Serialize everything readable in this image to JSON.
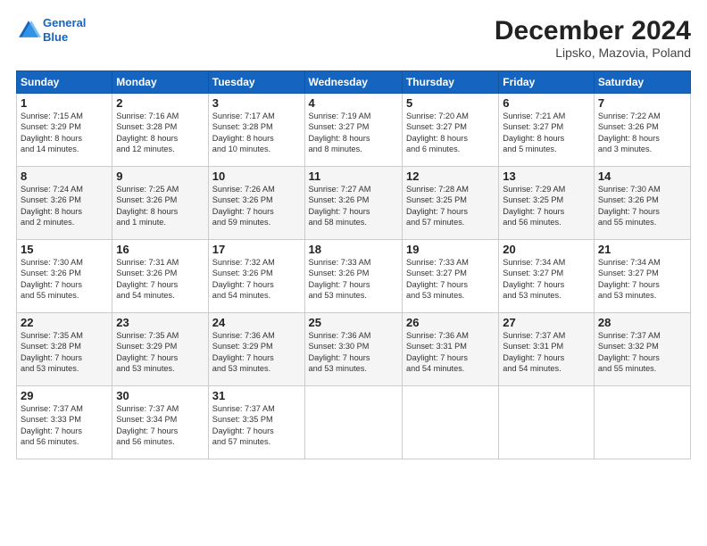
{
  "logo": {
    "line1": "General",
    "line2": "Blue"
  },
  "title": "December 2024",
  "subtitle": "Lipsko, Mazovia, Poland",
  "headers": [
    "Sunday",
    "Monday",
    "Tuesday",
    "Wednesday",
    "Thursday",
    "Friday",
    "Saturday"
  ],
  "weeks": [
    [
      {
        "day": "1",
        "info": "Sunrise: 7:15 AM\nSunset: 3:29 PM\nDaylight: 8 hours\nand 14 minutes."
      },
      {
        "day": "2",
        "info": "Sunrise: 7:16 AM\nSunset: 3:28 PM\nDaylight: 8 hours\nand 12 minutes."
      },
      {
        "day": "3",
        "info": "Sunrise: 7:17 AM\nSunset: 3:28 PM\nDaylight: 8 hours\nand 10 minutes."
      },
      {
        "day": "4",
        "info": "Sunrise: 7:19 AM\nSunset: 3:27 PM\nDaylight: 8 hours\nand 8 minutes."
      },
      {
        "day": "5",
        "info": "Sunrise: 7:20 AM\nSunset: 3:27 PM\nDaylight: 8 hours\nand 6 minutes."
      },
      {
        "day": "6",
        "info": "Sunrise: 7:21 AM\nSunset: 3:27 PM\nDaylight: 8 hours\nand 5 minutes."
      },
      {
        "day": "7",
        "info": "Sunrise: 7:22 AM\nSunset: 3:26 PM\nDaylight: 8 hours\nand 3 minutes."
      }
    ],
    [
      {
        "day": "8",
        "info": "Sunrise: 7:24 AM\nSunset: 3:26 PM\nDaylight: 8 hours\nand 2 minutes."
      },
      {
        "day": "9",
        "info": "Sunrise: 7:25 AM\nSunset: 3:26 PM\nDaylight: 8 hours\nand 1 minute."
      },
      {
        "day": "10",
        "info": "Sunrise: 7:26 AM\nSunset: 3:26 PM\nDaylight: 7 hours\nand 59 minutes."
      },
      {
        "day": "11",
        "info": "Sunrise: 7:27 AM\nSunset: 3:26 PM\nDaylight: 7 hours\nand 58 minutes."
      },
      {
        "day": "12",
        "info": "Sunrise: 7:28 AM\nSunset: 3:25 PM\nDaylight: 7 hours\nand 57 minutes."
      },
      {
        "day": "13",
        "info": "Sunrise: 7:29 AM\nSunset: 3:25 PM\nDaylight: 7 hours\nand 56 minutes."
      },
      {
        "day": "14",
        "info": "Sunrise: 7:30 AM\nSunset: 3:26 PM\nDaylight: 7 hours\nand 55 minutes."
      }
    ],
    [
      {
        "day": "15",
        "info": "Sunrise: 7:30 AM\nSunset: 3:26 PM\nDaylight: 7 hours\nand 55 minutes."
      },
      {
        "day": "16",
        "info": "Sunrise: 7:31 AM\nSunset: 3:26 PM\nDaylight: 7 hours\nand 54 minutes."
      },
      {
        "day": "17",
        "info": "Sunrise: 7:32 AM\nSunset: 3:26 PM\nDaylight: 7 hours\nand 54 minutes."
      },
      {
        "day": "18",
        "info": "Sunrise: 7:33 AM\nSunset: 3:26 PM\nDaylight: 7 hours\nand 53 minutes."
      },
      {
        "day": "19",
        "info": "Sunrise: 7:33 AM\nSunset: 3:27 PM\nDaylight: 7 hours\nand 53 minutes."
      },
      {
        "day": "20",
        "info": "Sunrise: 7:34 AM\nSunset: 3:27 PM\nDaylight: 7 hours\nand 53 minutes."
      },
      {
        "day": "21",
        "info": "Sunrise: 7:34 AM\nSunset: 3:27 PM\nDaylight: 7 hours\nand 53 minutes."
      }
    ],
    [
      {
        "day": "22",
        "info": "Sunrise: 7:35 AM\nSunset: 3:28 PM\nDaylight: 7 hours\nand 53 minutes."
      },
      {
        "day": "23",
        "info": "Sunrise: 7:35 AM\nSunset: 3:29 PM\nDaylight: 7 hours\nand 53 minutes."
      },
      {
        "day": "24",
        "info": "Sunrise: 7:36 AM\nSunset: 3:29 PM\nDaylight: 7 hours\nand 53 minutes."
      },
      {
        "day": "25",
        "info": "Sunrise: 7:36 AM\nSunset: 3:30 PM\nDaylight: 7 hours\nand 53 minutes."
      },
      {
        "day": "26",
        "info": "Sunrise: 7:36 AM\nSunset: 3:31 PM\nDaylight: 7 hours\nand 54 minutes."
      },
      {
        "day": "27",
        "info": "Sunrise: 7:37 AM\nSunset: 3:31 PM\nDaylight: 7 hours\nand 54 minutes."
      },
      {
        "day": "28",
        "info": "Sunrise: 7:37 AM\nSunset: 3:32 PM\nDaylight: 7 hours\nand 55 minutes."
      }
    ],
    [
      {
        "day": "29",
        "info": "Sunrise: 7:37 AM\nSunset: 3:33 PM\nDaylight: 7 hours\nand 56 minutes."
      },
      {
        "day": "30",
        "info": "Sunrise: 7:37 AM\nSunset: 3:34 PM\nDaylight: 7 hours\nand 56 minutes."
      },
      {
        "day": "31",
        "info": "Sunrise: 7:37 AM\nSunset: 3:35 PM\nDaylight: 7 hours\nand 57 minutes."
      },
      null,
      null,
      null,
      null
    ]
  ]
}
